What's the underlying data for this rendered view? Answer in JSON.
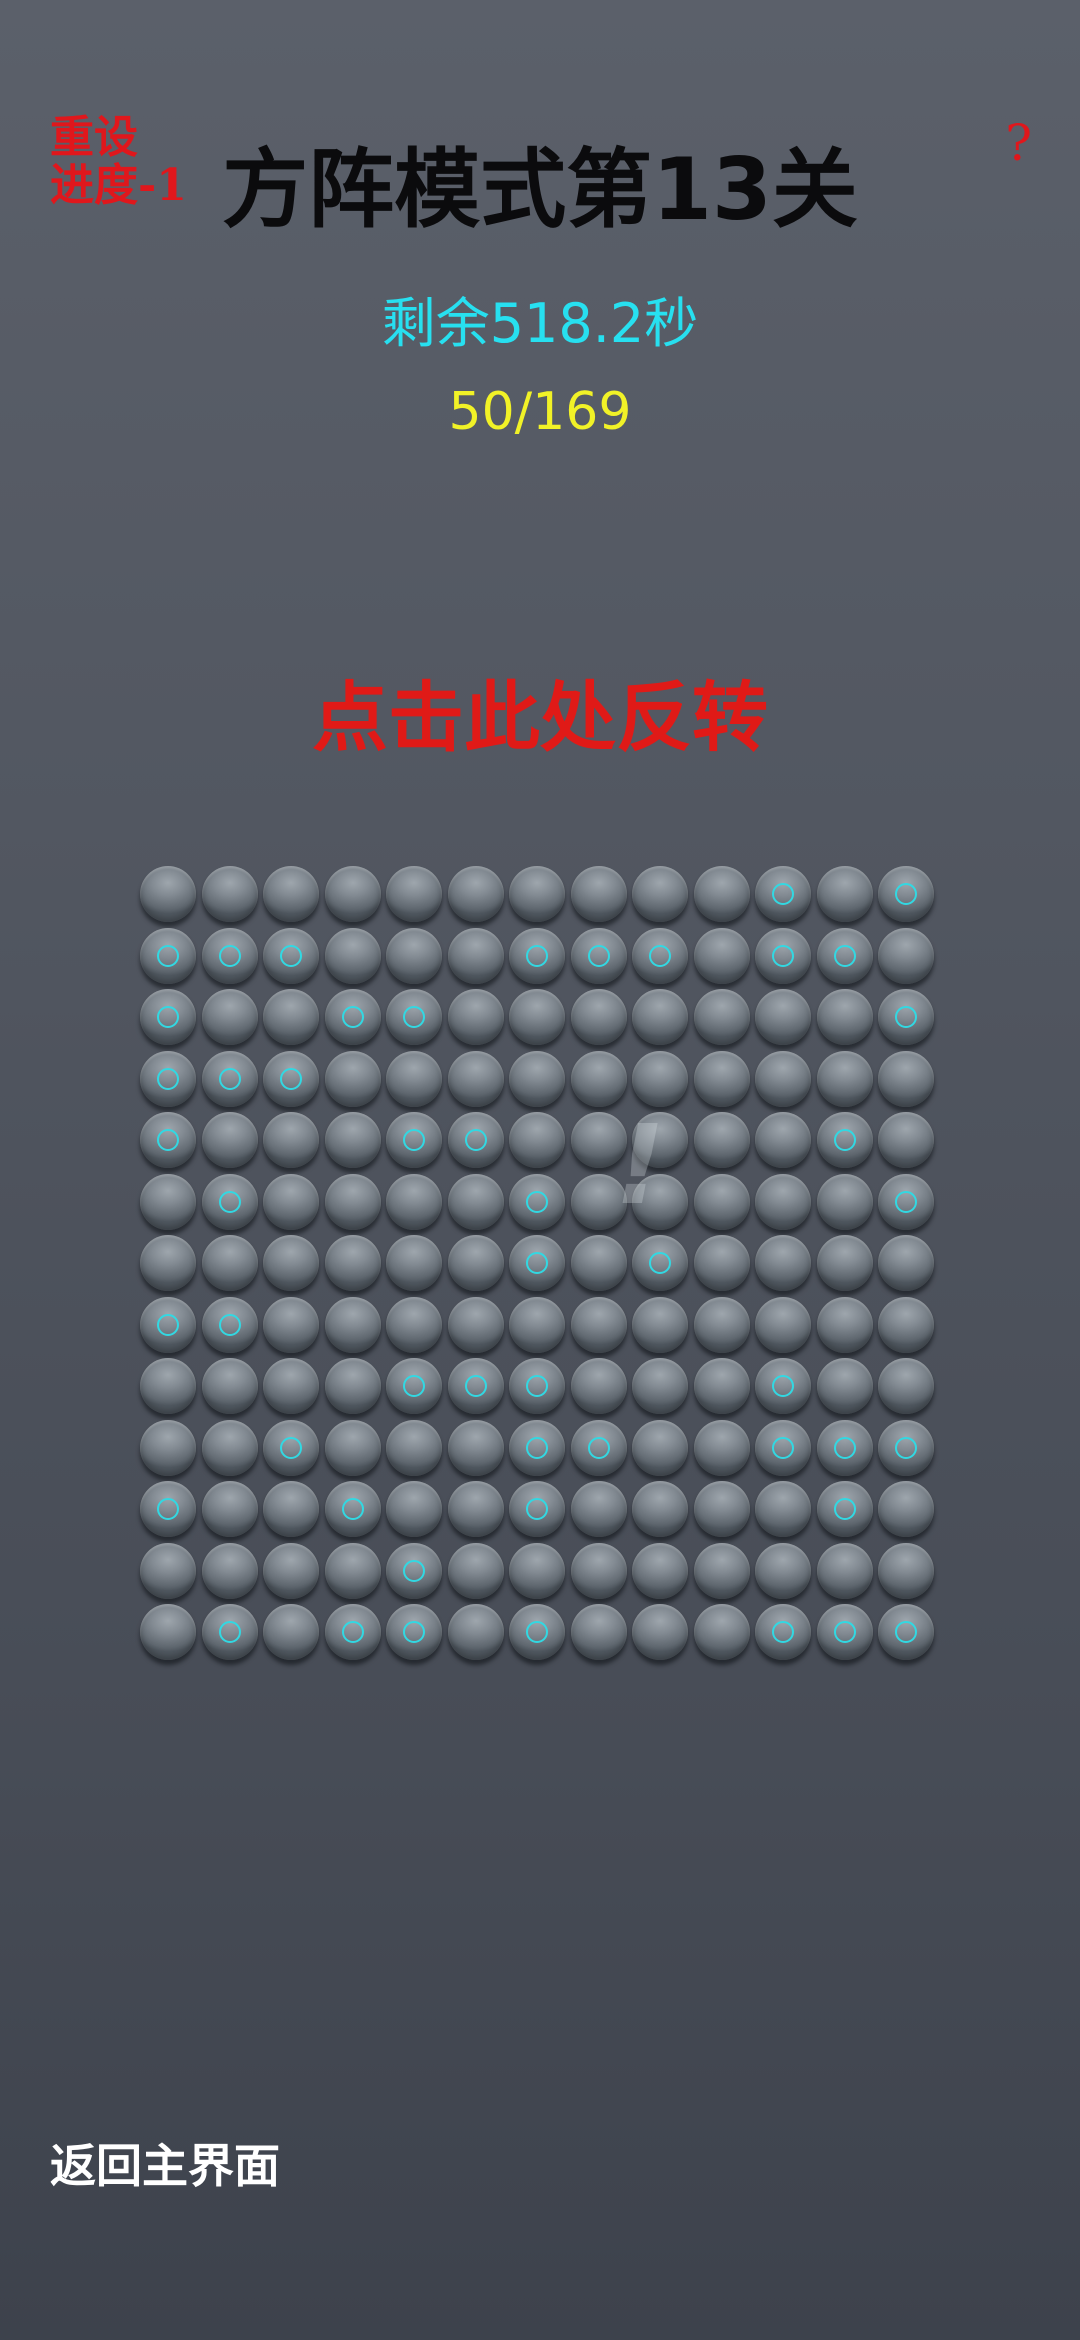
{
  "header": {
    "reset_label": "重设\n进度-1",
    "title": "方阵模式第13关",
    "help_label": "?"
  },
  "status": {
    "timer_text": "剩余518.2秒",
    "progress_text": "50/169"
  },
  "controls": {
    "flip_label": "点击此处反转",
    "back_label": "返回主界面"
  },
  "board": {
    "rows": 13,
    "cols": 13,
    "hint_symbol": "!",
    "accent_color": "#32d8e2",
    "cells": [
      [
        0,
        0,
        0,
        0,
        0,
        0,
        0,
        0,
        0,
        0,
        1,
        0,
        1
      ],
      [
        1,
        1,
        1,
        0,
        0,
        0,
        1,
        1,
        1,
        0,
        1,
        1,
        0
      ],
      [
        1,
        0,
        0,
        1,
        1,
        0,
        0,
        0,
        0,
        0,
        0,
        0,
        1
      ],
      [
        1,
        1,
        1,
        0,
        0,
        0,
        0,
        0,
        0,
        0,
        0,
        0,
        0
      ],
      [
        1,
        0,
        0,
        0,
        1,
        1,
        0,
        0,
        0,
        0,
        0,
        1,
        0
      ],
      [
        0,
        1,
        0,
        0,
        0,
        0,
        1,
        0,
        0,
        0,
        0,
        0,
        1
      ],
      [
        0,
        0,
        0,
        0,
        0,
        0,
        1,
        0,
        1,
        0,
        0,
        0,
        0
      ],
      [
        1,
        1,
        0,
        0,
        0,
        0,
        0,
        0,
        0,
        0,
        0,
        0,
        0
      ],
      [
        0,
        0,
        0,
        0,
        1,
        1,
        1,
        0,
        0,
        0,
        1,
        0,
        0
      ],
      [
        0,
        0,
        1,
        0,
        0,
        0,
        1,
        1,
        0,
        0,
        1,
        1,
        1
      ],
      [
        1,
        0,
        0,
        1,
        0,
        0,
        1,
        0,
        0,
        0,
        0,
        1,
        0
      ],
      [
        0,
        0,
        0,
        0,
        1,
        0,
        0,
        0,
        0,
        0,
        0,
        0,
        0
      ],
      [
        0,
        1,
        0,
        1,
        1,
        0,
        1,
        0,
        0,
        0,
        1,
        1,
        1
      ]
    ]
  },
  "colors": {
    "reset": "#e0171c",
    "title": "#0b0b0d",
    "timer": "#27e0f0",
    "progress": "#f1f227",
    "flip": "#e01a17",
    "back": "#ffffff"
  }
}
